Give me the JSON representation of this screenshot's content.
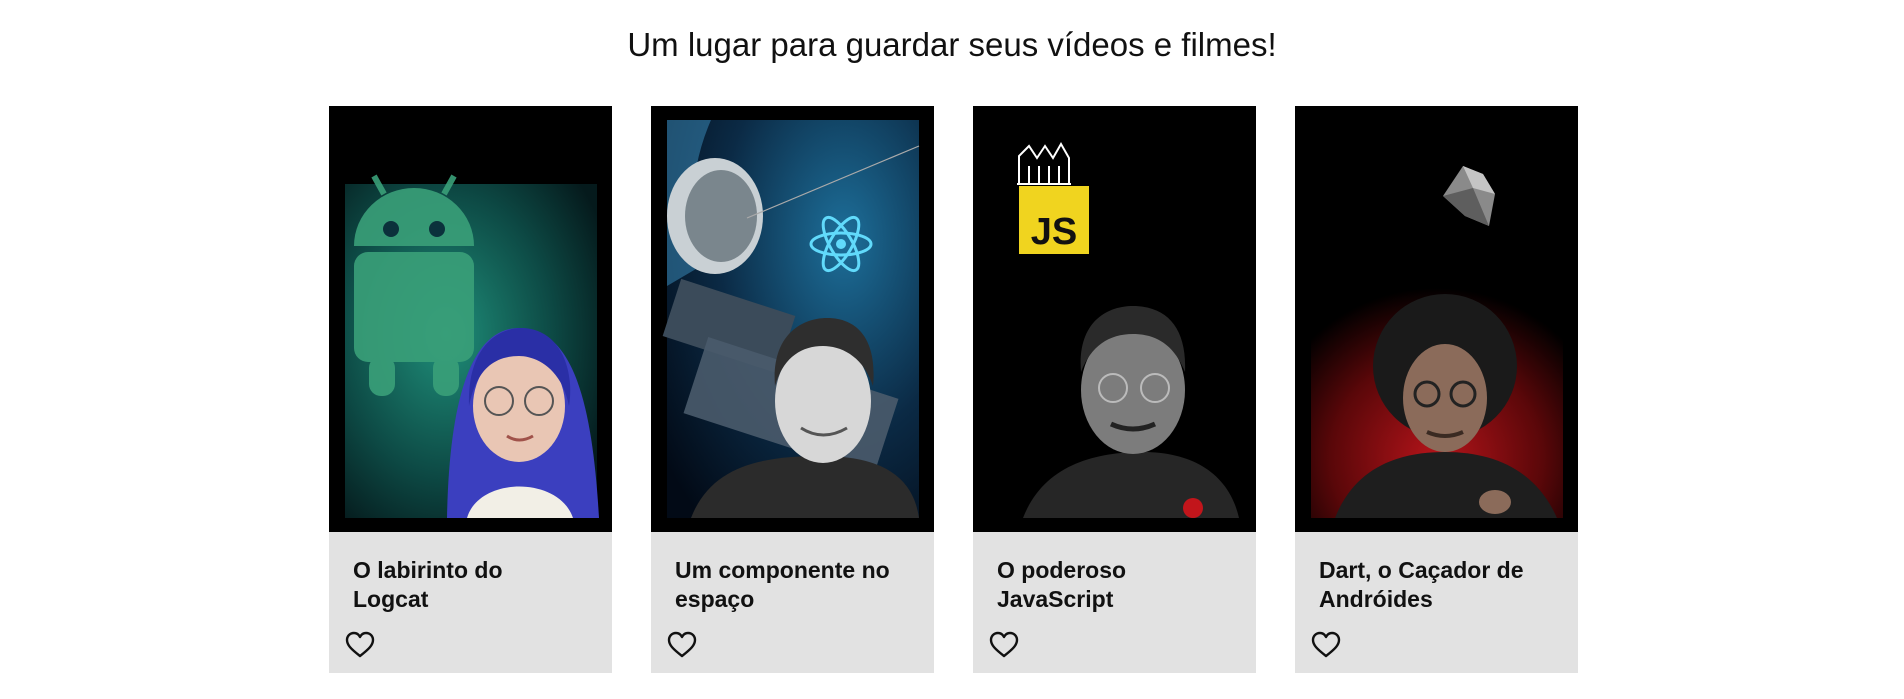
{
  "header": {
    "headline": "Um lugar para guardar seus vídeos e filmes!"
  },
  "cards": [
    {
      "title": "O labirinto do Logcat",
      "theme": "android",
      "accent": "#2fb79a"
    },
    {
      "title": "Um componente no espaço",
      "theme": "react-space",
      "accent": "#61dafb"
    },
    {
      "title": "O poderoso JavaScript",
      "theme": "javascript",
      "accent": "#f0d41f"
    },
    {
      "title": "Dart, o Caçador de Andróides",
      "theme": "dart",
      "accent": "#c0161b"
    }
  ],
  "icons": {
    "favorite": "heart-outline-icon"
  }
}
